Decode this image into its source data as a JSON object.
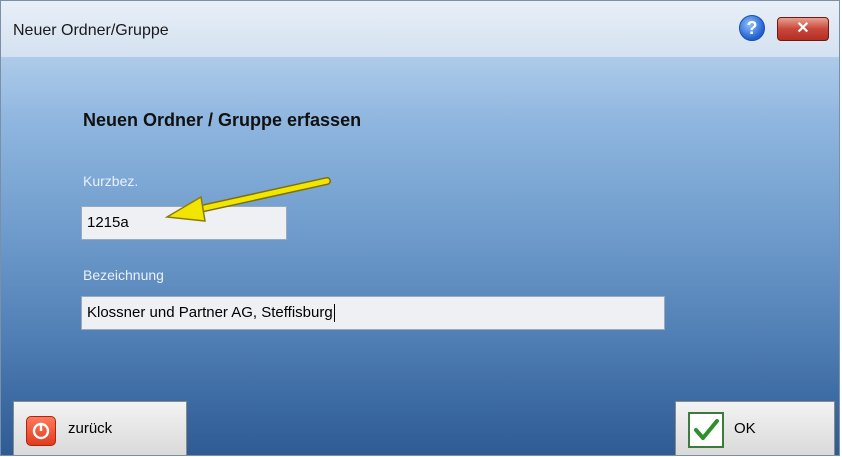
{
  "window": {
    "title": "Neuer Ordner/Gruppe",
    "help_icon": "help-icon",
    "close_icon": "close-icon"
  },
  "form": {
    "heading": "Neuen Ordner / Gruppe erfassen",
    "short_label": "Kurzbez.",
    "short_value": "1215a",
    "desc_label": "Bezeichnung",
    "desc_value": "Klossner und Partner AG, Steffisburg"
  },
  "buttons": {
    "back_label": "zurück",
    "back_icon": "power-icon",
    "ok_label": "OK",
    "ok_icon": "checkmark-icon"
  },
  "colors": {
    "annotation_arrow": "#f2e600",
    "accent_red": "#e23b1e",
    "accent_green": "#3d7a3d"
  }
}
